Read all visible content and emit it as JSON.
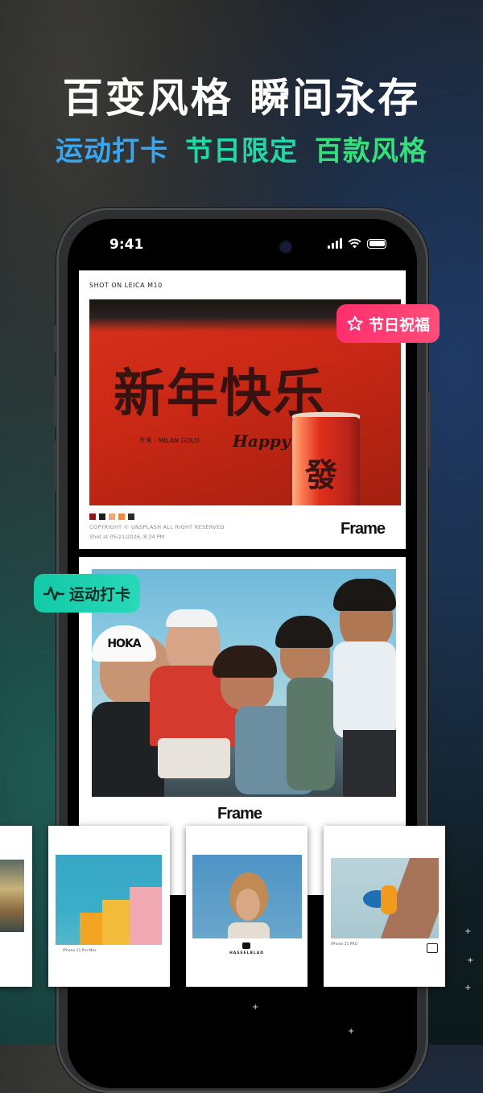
{
  "headline": "百变风格 瞬间永存",
  "subline": [
    {
      "text": "运动打卡",
      "color": "#37a7f2"
    },
    {
      "text": "节日限定",
      "color": "#23d8a8"
    },
    {
      "text": "百款风格",
      "color": "#34e07a"
    }
  ],
  "status_bar": {
    "time": "9:41"
  },
  "card1": {
    "label": "SHOT ON LEICA M10",
    "photo_text": "新年快乐",
    "photo_small": "千禾 · MILAN GOLD",
    "photo_happy": "Happy",
    "can_glyph": "發",
    "swatches": [
      "#8b1a14",
      "#1c1c1c",
      "#f3a57a",
      "#f08a3a",
      "#2b2b2b"
    ],
    "copyright": "COPYRIGHT © UNSPLASH ALL RIGHT RESERVED",
    "shot_at": "Shot at 05/21/2026, 8:34 PM",
    "logo": "Frame"
  },
  "card2": {
    "cap_text": "HOKA",
    "logo": "Frame"
  },
  "badges": {
    "festival": {
      "label": "节日祝福",
      "icon": "star-icon"
    },
    "sport": {
      "label": "运动打卡",
      "icon": "activity-pulse-icon"
    }
  },
  "strip": [
    {
      "caption": "iPhone 11 Pro Max"
    },
    {
      "caption": "HASSELBLAD"
    },
    {
      "caption": "iPhone 11 PRO"
    }
  ]
}
